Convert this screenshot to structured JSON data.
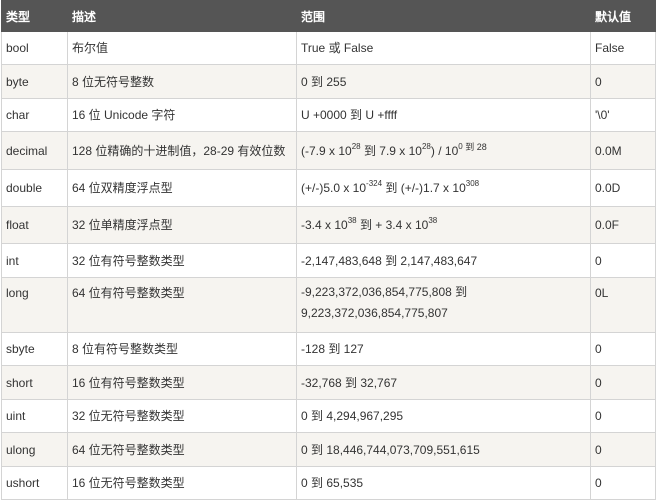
{
  "headers": [
    "类型",
    "描述",
    "范围",
    "默认值"
  ],
  "rows": [
    {
      "type": "bool",
      "desc": "布尔值",
      "range": "True 或 False",
      "default": "False"
    },
    {
      "type": "byte",
      "desc": "8 位无符号整数",
      "range": "0 到 255",
      "default": "0"
    },
    {
      "type": "char",
      "desc": "16 位 Unicode 字符",
      "range": "U +0000 到 U +ffff",
      "default": "'\\0'"
    },
    {
      "type": "decimal",
      "desc": "128 位精确的十进制值，28-29 有效位数",
      "range_parts": {
        "a": "(-7.9 x 10",
        "exp1": "28",
        "b": " 到 7.9 x 10",
        "exp2": "28",
        "c": ") / 10",
        "exp3": "0",
        "tail": " 到 28"
      },
      "default": "0.0M"
    },
    {
      "type": "double",
      "desc": "64 位双精度浮点型",
      "range_parts": {
        "a": "(+/-)5.0 x 10",
        "exp1": "-324",
        "b": " 到 (+/-)1.7 x 10",
        "exp2": "308"
      },
      "default": "0.0D"
    },
    {
      "type": "float",
      "desc": "32 位单精度浮点型",
      "range_parts": {
        "a": "-3.4 x 10",
        "exp1": "38",
        "b": " 到 + 3.4 x 10",
        "exp2": "38"
      },
      "default": "0.0F"
    },
    {
      "type": "int",
      "desc": "32 位有符号整数类型",
      "range": "-2,147,483,648 到 2,147,483,647",
      "default": "0"
    },
    {
      "type": "long",
      "desc": "64 位有符号整数类型",
      "range_line1": "-9,223,372,036,854,775,808 到",
      "range_line2": "9,223,372,036,854,775,807",
      "default": "0L"
    },
    {
      "type": "sbyte",
      "desc": "8 位有符号整数类型",
      "range": "-128 到 127",
      "default": "0"
    },
    {
      "type": "short",
      "desc": "16 位有符号整数类型",
      "range": "-32,768 到 32,767",
      "default": "0"
    },
    {
      "type": "uint",
      "desc": "32 位无符号整数类型",
      "range": "0 到 4,294,967,295",
      "default": "0"
    },
    {
      "type": "ulong",
      "desc": "64 位无符号整数类型",
      "range": "0 到 18,446,744,073,709,551,615",
      "default": "0"
    },
    {
      "type": "ushort",
      "desc": "16 位无符号整数类型",
      "range": "0 到 65,535",
      "default": "0"
    }
  ]
}
